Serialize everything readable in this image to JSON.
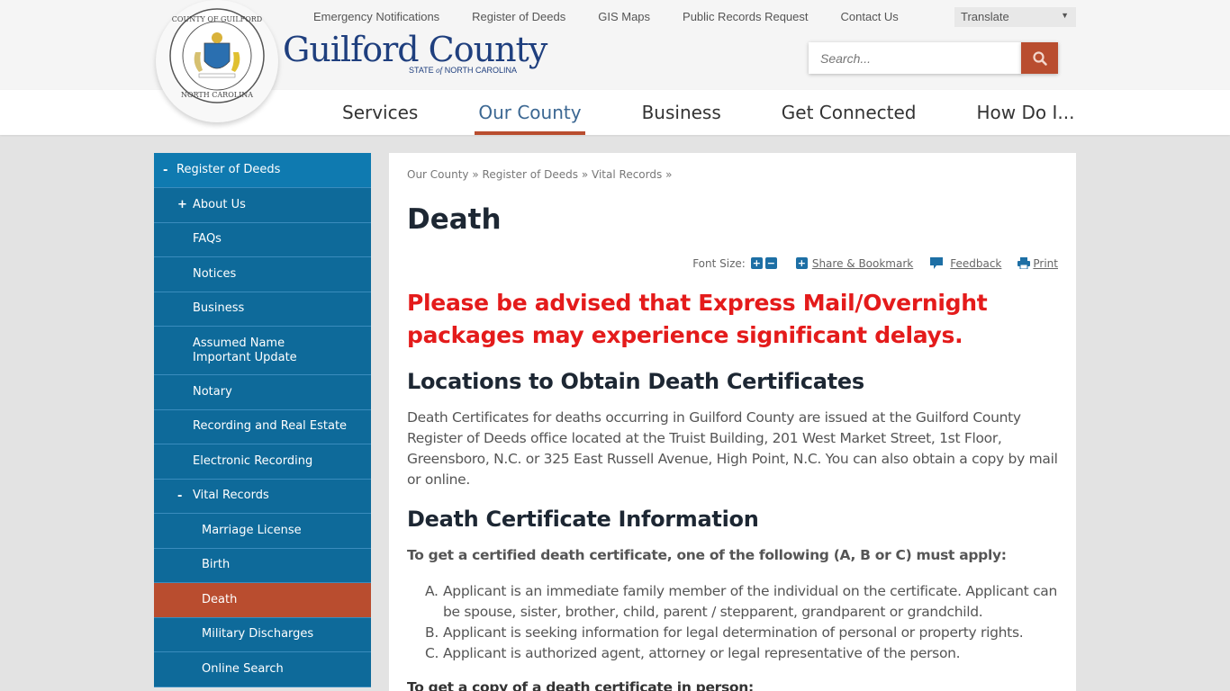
{
  "header": {
    "logo": {
      "name": "Guilford County",
      "state_pre": "STATE ",
      "state_of": "of",
      "state_post": " NORTH CAROLINA",
      "seal_top": "COUNTY OF GUILFORD",
      "seal_bottom": "NORTH CAROLINA"
    },
    "utility_links": [
      "Emergency Notifications",
      "Register of Deeds",
      "GIS Maps",
      "Public Records Request",
      "Contact Us"
    ],
    "translate": {
      "label": "Translate",
      "icon": "caret-down-icon"
    },
    "search": {
      "placeholder": "Search...",
      "button_icon": "search-icon"
    },
    "main_nav": [
      {
        "label": "Services",
        "active": false
      },
      {
        "label": "Our County",
        "active": true
      },
      {
        "label": "Business",
        "active": false
      },
      {
        "label": "Get Connected",
        "active": false
      },
      {
        "label": "How Do I...",
        "active": false
      }
    ]
  },
  "sidebar": {
    "items": [
      {
        "label": "Register of Deeds",
        "toggle": "-"
      },
      {
        "label": "About Us",
        "toggle": "+"
      },
      {
        "label": "FAQs",
        "toggle": ""
      },
      {
        "label": "Notices",
        "toggle": ""
      },
      {
        "label": "Business",
        "toggle": ""
      },
      {
        "label": "Assumed Name Important Update",
        "toggle": ""
      },
      {
        "label": "Notary",
        "toggle": ""
      },
      {
        "label": "Recording and Real Estate",
        "toggle": ""
      },
      {
        "label": "Electronic Recording",
        "toggle": ""
      },
      {
        "label": "Vital Records",
        "toggle": "-"
      },
      {
        "label": "Marriage License",
        "toggle": ""
      },
      {
        "label": "Birth",
        "toggle": ""
      },
      {
        "label": "Death",
        "toggle": "",
        "active": true
      },
      {
        "label": "Military Discharges",
        "toggle": ""
      },
      {
        "label": "Online Search",
        "toggle": ""
      }
    ]
  },
  "content": {
    "breadcrumb": [
      "Our County",
      "Register of Deeds",
      "Vital Records"
    ],
    "breadcrumb_sep": "»",
    "title": "Death",
    "toolbar": {
      "font_size_label": "Font Size:",
      "increase": "+",
      "decrease": "−",
      "share_label": "Share & Bookmark",
      "feedback_label": "Feedback",
      "print_label": "Print"
    },
    "alert": "Please be advised that Express Mail/Overnight packages may experience significant delays.",
    "section1_heading": "Locations to Obtain Death Certificates",
    "section1_text": "Death Certificates for deaths occurring in Guilford County are issued at the Guilford County Register of Deeds office located at the Truist Building, 201 West Market Street, 1st Floor, Greensboro, N.C. or 325 East Russell Avenue, High Point, N.C. You can also obtain a copy by mail or online.",
    "section2_heading": "Death Certificate Information",
    "section2_lead": "To get a certified death certificate, one of the following (A, B or C) must apply:",
    "requirements": [
      {
        "marker": "A.",
        "text": "Applicant is an immediate family member of the individual on the certificate. Applicant can be spouse, sister, brother, child, parent / stepparent, grandparent or grandchild."
      },
      {
        "marker": "B.",
        "text": "Applicant is seeking information for legal determination of personal or property rights."
      },
      {
        "marker": "C.",
        "text": "Applicant is authorized agent, attorney or legal representative of the person."
      }
    ],
    "section3_lead": "To get a copy of a death certificate in person:"
  },
  "colors": {
    "brand_blue": "#1f3f7e",
    "sidebar_blue": "#0e6a9a",
    "accent_orange": "#b94d2f",
    "alert_red": "#e41b1b"
  }
}
